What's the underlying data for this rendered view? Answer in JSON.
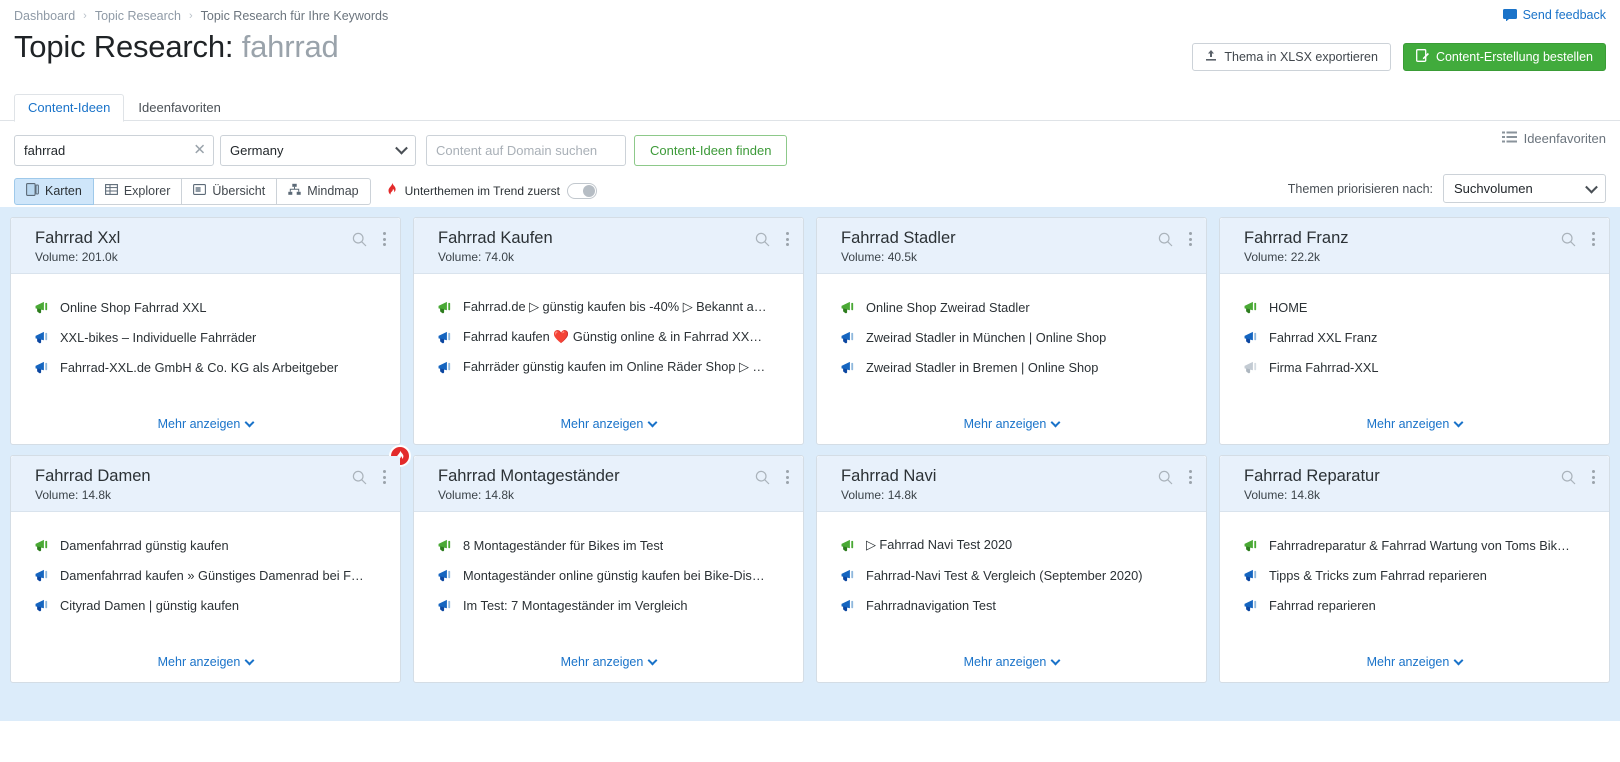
{
  "breadcrumb": {
    "items": [
      "Dashboard",
      "Topic Research",
      "Topic Research für Ihre Keywords"
    ],
    "separator": "›"
  },
  "feedback": {
    "label": "Send feedback",
    "icon": "feedback-icon",
    "color": "#1a73c9"
  },
  "header": {
    "title_prefix": "Topic Research:",
    "title_keyword": "fahrrad",
    "export_button": "Thema in XLSX exportieren",
    "order_button": "Content-Erstellung bestellen",
    "order_button_color": "#41ab3c"
  },
  "tabs": [
    {
      "label": "Content-Ideen",
      "active": true
    },
    {
      "label": "Ideenfavoriten",
      "active": false
    }
  ],
  "filters": {
    "keyword_value": "fahrrad",
    "keyword_clear": "✕",
    "country_value": "Germany",
    "domain_placeholder": "Content auf Domain suchen",
    "domain_value": "",
    "find_button": "Content-Ideen finden",
    "favorites_link": "Ideenfavoriten"
  },
  "viewbar": {
    "views": [
      {
        "label": "Karten",
        "icon": "cards-icon",
        "active": true
      },
      {
        "label": "Explorer",
        "icon": "table-icon",
        "active": false
      },
      {
        "label": "Übersicht",
        "icon": "overview-icon",
        "active": false
      },
      {
        "label": "Mindmap",
        "icon": "mindmap-icon",
        "active": false
      }
    ],
    "trend_toggle_label": "Unterthemen im Trend zuerst",
    "trend_toggle_on": false,
    "prioritize_label": "Themen priorisieren nach:",
    "prioritize_value": "Suchvolumen"
  },
  "card_labels": {
    "volume_prefix": "Volume:",
    "more": "Mehr anzeigen"
  },
  "cards": [
    {
      "title": "Fahrrad Xxl",
      "volume": "201.0k",
      "trending": false,
      "ideas": [
        {
          "text": "Online Shop Fahrrad XXL",
          "icon": "megaphone-green"
        },
        {
          "text": "XXL-bikes – Individuelle Fahrräder",
          "icon": "megaphone-blue"
        },
        {
          "text": "Fahrrad-XXL.de GmbH & Co. KG als Arbeitgeber",
          "icon": "megaphone-blue"
        }
      ]
    },
    {
      "title": "Fahrrad Kaufen",
      "volume": "74.0k",
      "trending": false,
      "ideas": [
        {
          "text": "Fahrrad.de ▷ günstig kaufen bis -40% ▷ Bekannt a…",
          "icon": "megaphone-green"
        },
        {
          "text": "Fahrrad kaufen ❤️ Günstig online & in Fahrrad XX…",
          "icon": "megaphone-blue"
        },
        {
          "text": "Fahrräder günstig kaufen im Online Räder Shop ▷ …",
          "icon": "megaphone-blue"
        }
      ]
    },
    {
      "title": "Fahrrad Stadler",
      "volume": "40.5k",
      "trending": false,
      "ideas": [
        {
          "text": "Online Shop Zweirad Stadler",
          "icon": "megaphone-green"
        },
        {
          "text": "Zweirad Stadler in München | Online Shop",
          "icon": "megaphone-blue"
        },
        {
          "text": "Zweirad Stadler in Bremen | Online Shop",
          "icon": "megaphone-blue"
        }
      ]
    },
    {
      "title": "Fahrrad Franz",
      "volume": "22.2k",
      "trending": false,
      "ideas": [
        {
          "text": "HOME",
          "icon": "megaphone-green"
        },
        {
          "text": "Fahrrad XXL Franz",
          "icon": "megaphone-blue"
        },
        {
          "text": "Firma Fahrrad-XXL",
          "icon": "megaphone-gray"
        }
      ]
    },
    {
      "title": "Fahrrad Damen",
      "volume": "14.8k",
      "trending": true,
      "ideas": [
        {
          "text": "Damenfahrrad günstig kaufen",
          "icon": "megaphone-green"
        },
        {
          "text": "Damenfahrrad kaufen » Günstiges Damenrad bei F…",
          "icon": "megaphone-blue"
        },
        {
          "text": "Cityrad Damen | günstig kaufen",
          "icon": "megaphone-blue"
        }
      ]
    },
    {
      "title": "Fahrrad Montageständer",
      "volume": "14.8k",
      "trending": false,
      "ideas": [
        {
          "text": "8 Montageständer für Bikes im Test",
          "icon": "megaphone-green"
        },
        {
          "text": "Montageständer online günstig kaufen bei Bike-Dis…",
          "icon": "megaphone-blue"
        },
        {
          "text": "Im Test: 7 Montageständer im Vergleich",
          "icon": "megaphone-blue"
        }
      ]
    },
    {
      "title": "Fahrrad Navi",
      "volume": "14.8k",
      "trending": false,
      "ideas": [
        {
          "text": "▷ Fahrrad Navi Test 2020",
          "icon": "megaphone-green"
        },
        {
          "text": "Fahrrad-Navi Test & Vergleich (September 2020)",
          "icon": "megaphone-blue"
        },
        {
          "text": "Fahrradnavigation Test",
          "icon": "megaphone-blue"
        }
      ]
    },
    {
      "title": "Fahrrad Reparatur",
      "volume": "14.8k",
      "trending": false,
      "ideas": [
        {
          "text": "Fahrradreparatur & Fahrrad Wartung von Toms Bik…",
          "icon": "megaphone-green"
        },
        {
          "text": "Tipps & Tricks zum Fahrrad reparieren",
          "icon": "megaphone-blue"
        },
        {
          "text": "Fahrrad reparieren",
          "icon": "megaphone-blue"
        }
      ]
    }
  ],
  "colors": {
    "page_bg": "#ffffff",
    "cards_bg": "#dcecfa",
    "card_header_bg": "#e8f1fb",
    "link": "#1a73c9",
    "green": "#41ab3c",
    "trend_red": "#e32b2b",
    "icon_green": "#4aa935",
    "icon_blue": "#1565c0"
  }
}
